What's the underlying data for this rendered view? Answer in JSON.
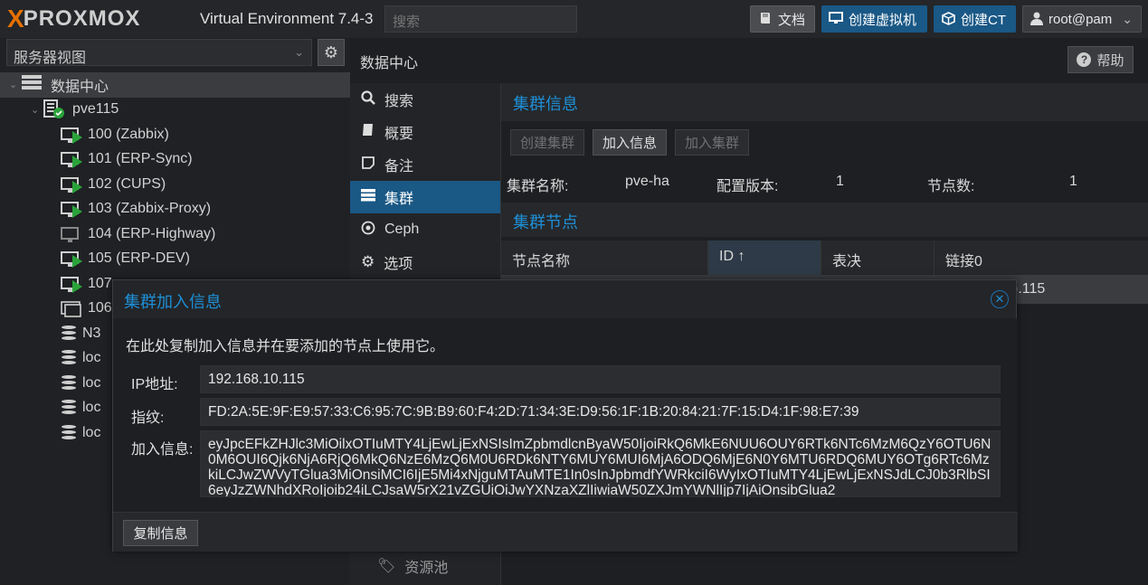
{
  "header": {
    "logo_x": "X",
    "logo_text": "PROXMOX",
    "version": "Virtual Environment 7.4-3",
    "search_placeholder": "搜索",
    "docs_label": "文档",
    "create_vm_label": "创建虚拟机",
    "create_ct_label": "创建CT",
    "user_label": "root@pam"
  },
  "sidebar": {
    "view_selector": "服务器视图",
    "tree": [
      {
        "label": "数据中心",
        "type": "datacenter"
      },
      {
        "label": "pve115",
        "type": "node"
      },
      {
        "label": "100 (Zabbix)",
        "type": "vm-running"
      },
      {
        "label": "101 (ERP-Sync)",
        "type": "vm-running"
      },
      {
        "label": "102 (CUPS)",
        "type": "vm-running"
      },
      {
        "label": "103 (Zabbix-Proxy)",
        "type": "vm-running"
      },
      {
        "label": "104 (ERP-Highway)",
        "type": "vm-stopped"
      },
      {
        "label": "105 (ERP-DEV)",
        "type": "vm-running"
      },
      {
        "label": "107",
        "type": "vm-running"
      },
      {
        "label": "106",
        "type": "template"
      },
      {
        "label": "N3",
        "type": "storage"
      },
      {
        "label": "loc",
        "type": "storage"
      },
      {
        "label": "loc",
        "type": "storage"
      },
      {
        "label": "loc",
        "type": "storage"
      },
      {
        "label": "loc",
        "type": "storage"
      }
    ]
  },
  "content": {
    "title": "数据中心",
    "help_label": "帮助",
    "nav": [
      {
        "label": "搜索",
        "icon": "search-icon"
      },
      {
        "label": "概要",
        "icon": "book-icon"
      },
      {
        "label": "备注",
        "icon": "note-icon"
      },
      {
        "label": "集群",
        "icon": "server-icon"
      },
      {
        "label": "Ceph",
        "icon": "ceph-icon"
      },
      {
        "label": "选项",
        "icon": "gear-icon"
      },
      {
        "label": "资源池",
        "icon": "tags-icon"
      }
    ],
    "cluster_info_title": "集群信息",
    "buttons": {
      "create_cluster": "创建集群",
      "join_info": "加入信息",
      "join_cluster": "加入集群"
    },
    "cluster_name_label": "集群名称:",
    "cluster_name": "pve-ha",
    "config_version_label": "配置版本:",
    "config_version": "1",
    "node_count_label": "节点数:",
    "node_count": "1",
    "cluster_nodes_title": "集群节点",
    "columns": [
      "节点名称",
      "ID ↑",
      "表决",
      "链接0"
    ],
    "row_partial": ").115"
  },
  "dialog": {
    "title": "集群加入信息",
    "description": "在此处复制加入信息并在要添加的节点上使用它。",
    "ip_label": "IP地址:",
    "ip_value": "192.168.10.115",
    "fingerprint_label": "指纹:",
    "fingerprint_value": "FD:2A:5E:9F:E9:57:33:C6:95:7C:9B:B9:60:F4:2D:71:34:3E:D9:56:1F:1B:20:84:21:7F:15:D4:1F:98:E7:39",
    "join_label": "加入信息:",
    "join_value": "eyJpcEFkZHJlc3MiOilxOTIuMTY4LjEwLjExNSIsImZpbmdlcnByaW50IjoiRkQ6MkE6NUU6OUY6RTk6NTc6MzM6QzY6OTU6N0M6OUI6Qjk6NjA6RjQ6MkQ6NzE6MzQ6M0U6RDk6NTY6MUY6MUI6MjA6ODQ6MjE6N0Y6MTU6RDQ6MUY6OTg6RTc6MzkiLCJwZWVyTGlua3MiOnsiMCI6IjE5Mi4xNjguMTAuMTE1In0sInJpbmdfYWRkciI6WyIxOTIuMTY4LjEwLjExNSJdLCJ0b3RlbSI6eyJzZWNhdXRoIjoib24iLCJsaW5rX21vZGUiOiJwYXNzaXZlIiwiaW50ZXJmYWNlIjp7IjAiOnsibGlua2",
    "copy_label": "复制信息"
  },
  "colors": {
    "accent": "#1e8fd6",
    "primary_button": "#1a5886",
    "running": "#2aa33a",
    "brand_orange": "#e57000"
  }
}
